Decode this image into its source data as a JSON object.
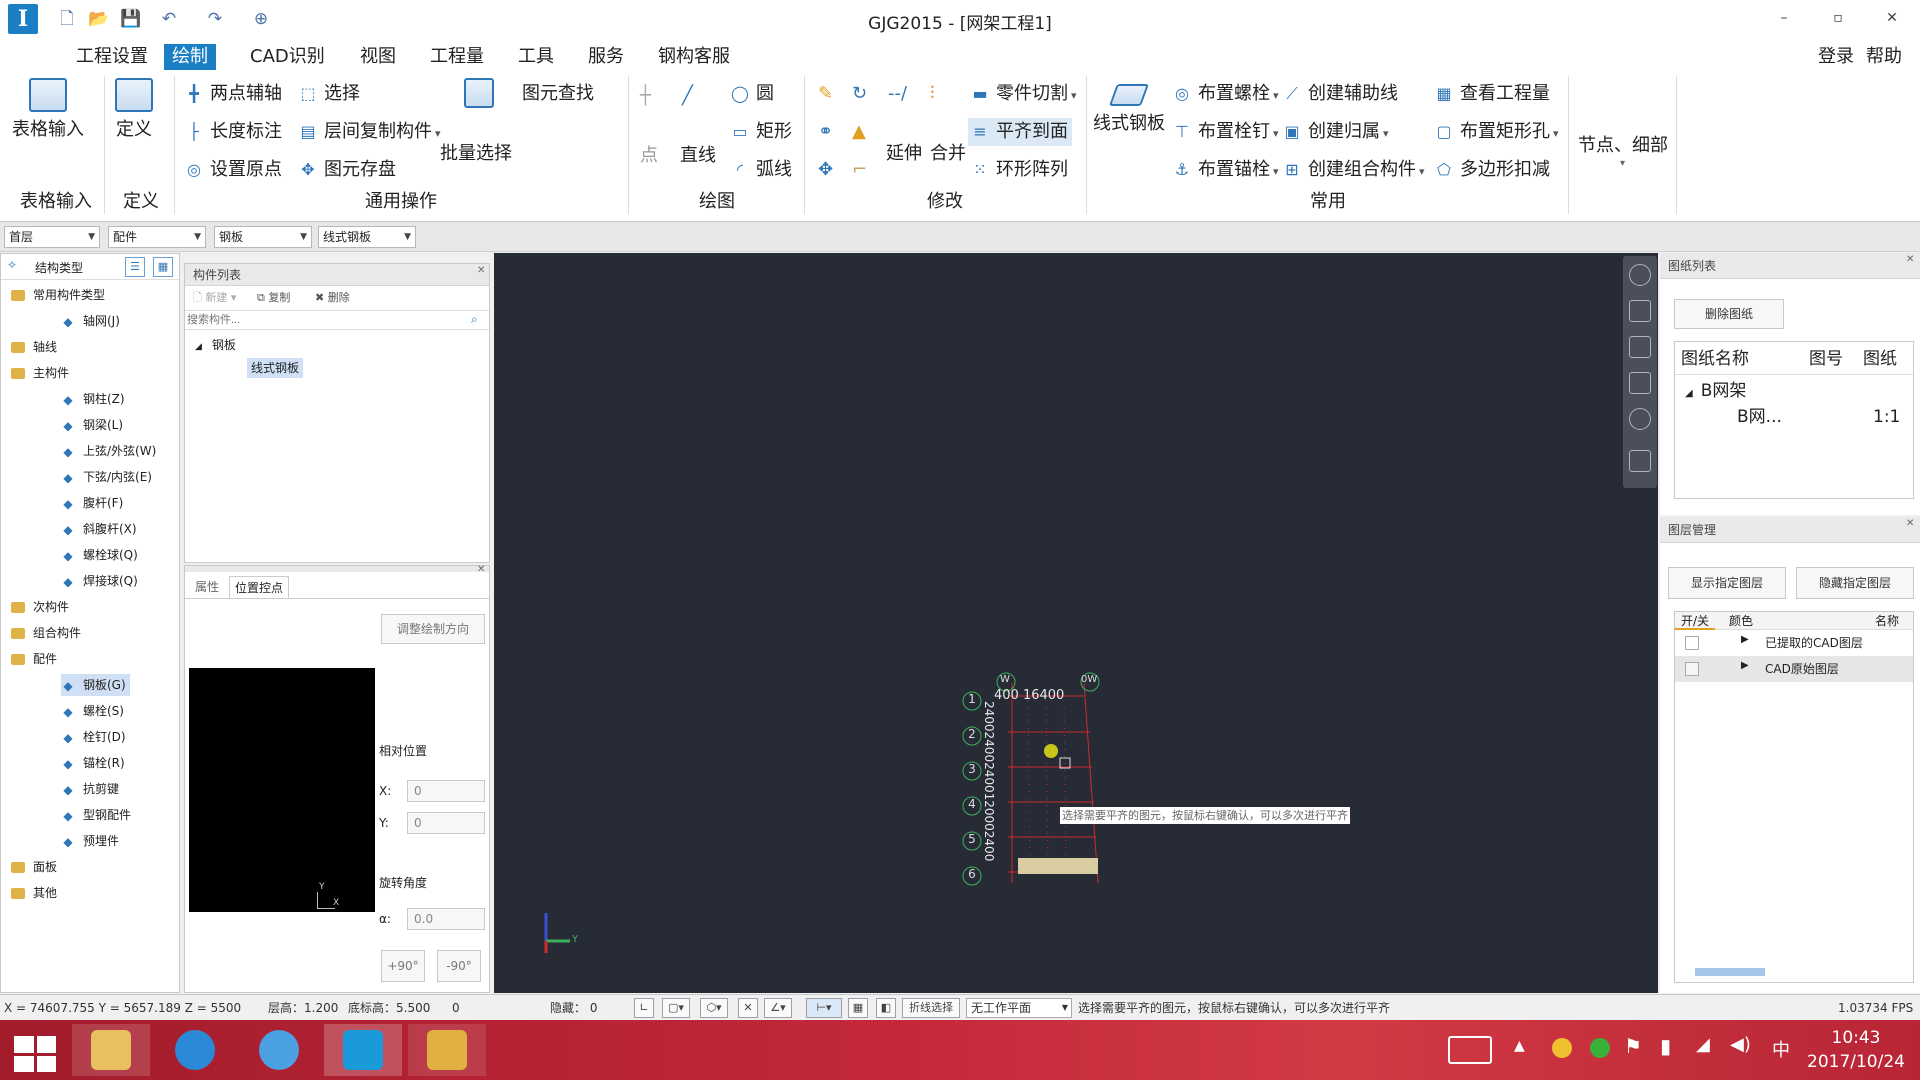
{
  "window": {
    "title": "GJG2015 - [网架工程1]",
    "app_logo": "I",
    "minimize": "–",
    "restore": "▫",
    "close": "✕"
  },
  "menu": {
    "items": [
      "工程设置",
      "绘制",
      "CAD识别",
      "视图",
      "工程量",
      "工具",
      "服务",
      "钢构客服"
    ],
    "active": "绘制",
    "login": "登录",
    "help": "帮助"
  },
  "ribbon": {
    "table_input": {
      "button": "表格输入",
      "group": "表格输入"
    },
    "define": {
      "button": "定义",
      "group": "定义"
    },
    "general": {
      "two_point_axis": "两点辅轴",
      "select": "选择",
      "find_element": "图元查找",
      "length_dim": "长度标注",
      "copy_between_floors": "层间复制构件",
      "batch_select": "批量选择",
      "set_origin": "设置原点",
      "save_element": "图元存盘",
      "group": "通用操作"
    },
    "draw": {
      "point": "点",
      "line": "直线",
      "circle": "圆",
      "rect": "矩形",
      "arc": "弧线",
      "group": "绘图"
    },
    "modify": {
      "extend": "延伸",
      "merge": "合并",
      "part_cut": "零件切割",
      "align_face": "平齐到面",
      "ring_array": "环形阵列",
      "group": "修改"
    },
    "common": {
      "linear_plate": "线式钢板",
      "place_bolt": "布置螺栓",
      "place_pin": "布置栓钉",
      "place_anchor": "布置锚栓",
      "create_aux_line": "创建辅助线",
      "create_belong": "创建归属",
      "create_combo": "创建组合构件",
      "view_quantity": "查看工程量",
      "place_rect_hole": "布置矩形孔",
      "polygon_deduct": "多边形扣减",
      "group": "常用"
    },
    "node_detail": "节点、细部"
  },
  "selectors": [
    "首层",
    "配件",
    "钢板",
    "线式钢板"
  ],
  "structure_panel": {
    "title": "结构类型",
    "items": [
      {
        "label": "常用构件类型",
        "level": 0
      },
      {
        "label": "轴网(J)",
        "level": 1
      },
      {
        "label": "轴线",
        "level": 0
      },
      {
        "label": "主构件",
        "level": 0
      },
      {
        "label": "钢柱(Z)",
        "level": 1
      },
      {
        "label": "钢梁(L)",
        "level": 1
      },
      {
        "label": "上弦/外弦(W)",
        "level": 1
      },
      {
        "label": "下弦/内弦(E)",
        "level": 1
      },
      {
        "label": "腹杆(F)",
        "level": 1
      },
      {
        "label": "斜腹杆(X)",
        "level": 1
      },
      {
        "label": "螺栓球(Q)",
        "level": 1
      },
      {
        "label": "焊接球(Q)",
        "level": 1
      },
      {
        "label": "次构件",
        "level": 0
      },
      {
        "label": "组合构件",
        "level": 0
      },
      {
        "label": "配件",
        "level": 0
      },
      {
        "label": "钢板(G)",
        "level": 1,
        "selected": true
      },
      {
        "label": "螺栓(S)",
        "level": 1
      },
      {
        "label": "栓钉(D)",
        "level": 1
      },
      {
        "label": "锚栓(R)",
        "level": 1
      },
      {
        "label": "抗剪键",
        "level": 1
      },
      {
        "label": "型钢配件",
        "level": 1
      },
      {
        "label": "预埋件",
        "level": 1
      },
      {
        "label": "面板",
        "level": 0
      },
      {
        "label": "其他",
        "level": 0
      }
    ]
  },
  "component_list": {
    "title": "构件列表",
    "new": "新建",
    "copy": "复制",
    "delete": "删除",
    "search_placeholder": "搜索构件...",
    "group": "钢板",
    "item": "线式钢板"
  },
  "props_panel": {
    "tab_attr": "属性",
    "tab_pos": "位置控点",
    "adjust_dir": "调整绘制方向",
    "rel_pos": "相对位置",
    "x_label": "X:",
    "x_value": "0",
    "y_label": "Y:",
    "y_value": "0",
    "rot_label": "旋转角度",
    "alpha_label": "α:",
    "alpha_value": "0.0",
    "plus90": "+90°",
    "minus90": "-90°",
    "preview_y": "Y",
    "preview_x": "X"
  },
  "canvas": {
    "axis_labels_rows": [
      "1",
      "2",
      "3",
      "4",
      "5",
      "6"
    ],
    "top_badges": [
      "W",
      "0W"
    ],
    "top_dims": "400 16400",
    "left_dims": "240024002400120002400",
    "tooltip": "选择需要平齐的图元，按鼠标右键确认，可以多次进行平齐",
    "axis_y": "Y",
    "colors": {
      "bg": "#262b36",
      "axis": "#3db25a",
      "grid": "#cf2b2b",
      "dot": "#c9c61a"
    }
  },
  "drawing_list": {
    "title": "图纸列表",
    "delete_btn": "删除图纸",
    "headers": [
      "图纸名称",
      "图号",
      "图纸"
    ],
    "group": "B网架",
    "row_name": "B网...",
    "row_scale": "1:1"
  },
  "layer_mgmt": {
    "title": "图层管理",
    "show_btn": "显示指定图层",
    "hide_btn": "隐藏指定图层",
    "headers": [
      "开/关",
      "颜色",
      "名称"
    ],
    "rows": [
      "已提取的CAD图层",
      "CAD原始图层"
    ]
  },
  "statusbar": {
    "coords": "X = 74607.755 Y = 5657.189 Z = 5500",
    "floor_height": "层高：1.200",
    "base_height": "底标高：5.500",
    "zero": "0",
    "hidden": "隐藏： 0",
    "polyline_select": "折线选择",
    "work_plane": "无工作平面",
    "hint": "选择需要平齐的图元，按鼠标右键确认，可以多次进行平齐",
    "fps": "1.03734 FPS"
  },
  "taskbar": {
    "ime": "中",
    "time": "10:43",
    "date": "2017/10/24"
  }
}
